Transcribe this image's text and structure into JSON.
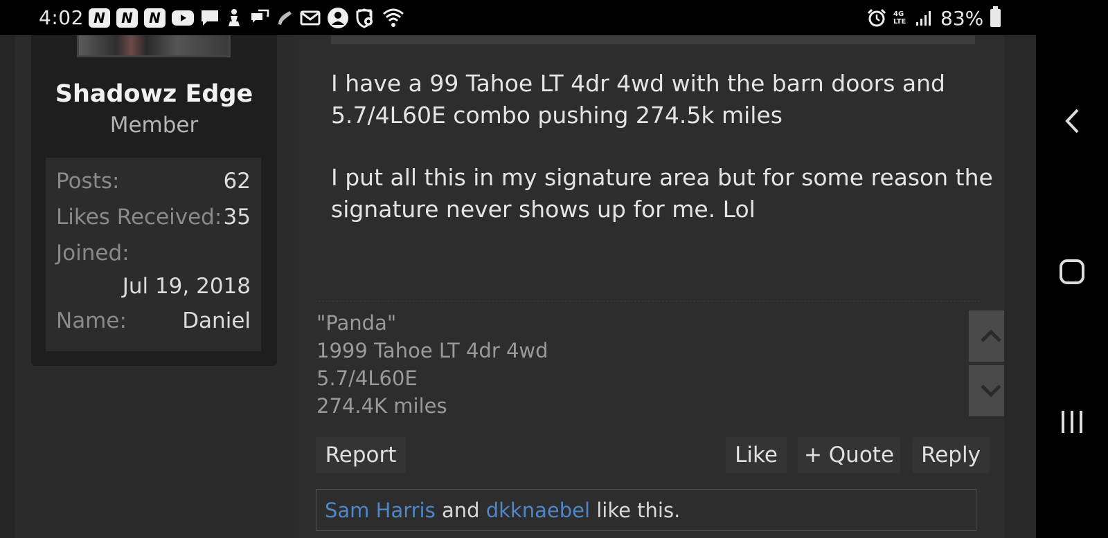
{
  "status_bar": {
    "time": "4:02",
    "battery": "83%",
    "network": "4G LTE",
    "left_icons": [
      "n-app-icon",
      "n-app-icon",
      "n-app-icon",
      "youtube-icon",
      "chat-icon",
      "accessibility-icon",
      "messages-icon",
      "phone-icon",
      "mail-icon",
      "account-icon",
      "vpn-shield-icon",
      "wifi-icon"
    ],
    "right_icons": [
      "alarm-icon",
      "signal-icon",
      "battery-icon"
    ]
  },
  "profile": {
    "username": "Shadowz Edge",
    "user_title": "Member",
    "stats": [
      {
        "label": "Posts:",
        "value": "62"
      },
      {
        "label": "Likes Received:",
        "value": "35"
      },
      {
        "label": "Joined:",
        "value": "Jul 19, 2018"
      },
      {
        "label": "Name:",
        "value": "Daniel"
      }
    ]
  },
  "post": {
    "message_lines": [
      "I have a 99 Tahoe LT 4dr 4wd with the barn doors and",
      "5.7/4L60E combo pushing 274.5k miles",
      "I put all this in my signature area but for some reason the",
      "signature never shows up for me. Lol"
    ],
    "signature_lines": [
      "\"Panda\"",
      "1999 Tahoe LT 4dr 4wd",
      "5.7/4L60E",
      "274.4K miles"
    ],
    "actions": {
      "report": "Report",
      "like": "Like",
      "quote": "+ Quote",
      "reply": "Reply"
    },
    "likes": {
      "user1": "Sam Harris",
      "conj": " and ",
      "user2": "dkknaebel",
      "suffix": " like this."
    }
  },
  "colors": {
    "background": "#2b2b2b",
    "profile_card": "#1e1e1e",
    "link": "#4e86c8",
    "text": "#e4e4e4"
  }
}
